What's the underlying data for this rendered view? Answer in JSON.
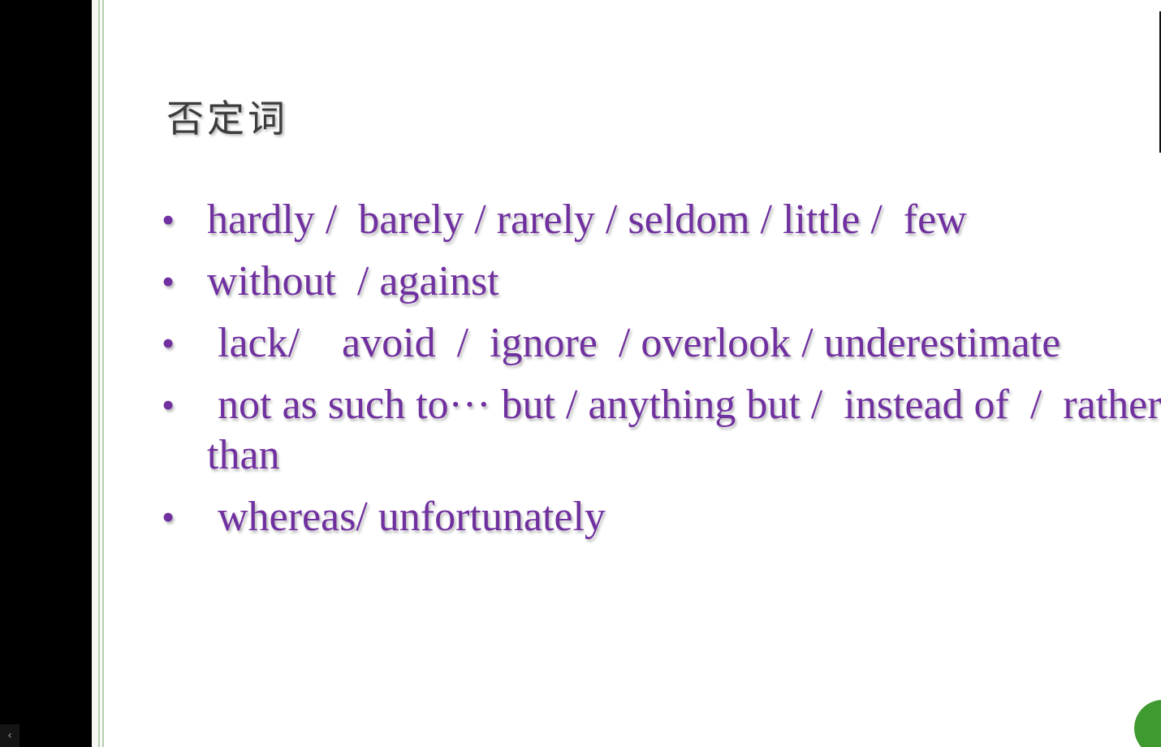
{
  "slide": {
    "title": "否定词",
    "bullet_symbol": "•",
    "bullets": [
      "hardly /  barely / rarely / seldom / little /  few",
      "without  / against",
      " lack/    avoid  /  ignore  / overlook / underestimate",
      " not as such to··· but / anything but /  instead of  /  rather than",
      " whereas/ unfortunately"
    ]
  },
  "sidebar": {
    "collapse_icon_glyph": "‹"
  },
  "colors": {
    "bullet_text": "#7030a0",
    "title_text": "#3c3c3c",
    "accent_green": "#3f9a2f",
    "edge_green": "#b8cdb0"
  }
}
